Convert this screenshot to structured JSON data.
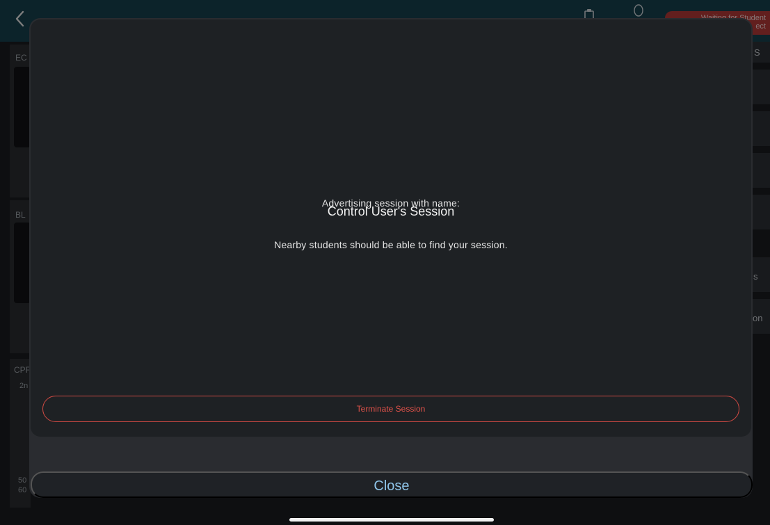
{
  "status": {
    "badge_line1": "Waiting for Student",
    "badge_line2": "ect"
  },
  "background": {
    "panel_labels": [
      "EC",
      "BL",
      "CPF"
    ],
    "cpr_values": [
      "2n",
      "50",
      "60"
    ],
    "right_fragments": [
      "S",
      "s",
      "on"
    ]
  },
  "modal": {
    "lead_text": "Advertising session with name:",
    "session_name": "Control User's Session",
    "hint_text": "Nearby students should be able to find your session.",
    "terminate_label": "Terminate Session"
  },
  "footer": {
    "close_label": "Close"
  },
  "colors": {
    "accent_red": "#d24a43",
    "accent_blue": "#8ec4e8",
    "topbar": "#17414e"
  },
  "icons": [
    "chevron-left-icon",
    "clipboard-icon",
    "mic-icon"
  ]
}
